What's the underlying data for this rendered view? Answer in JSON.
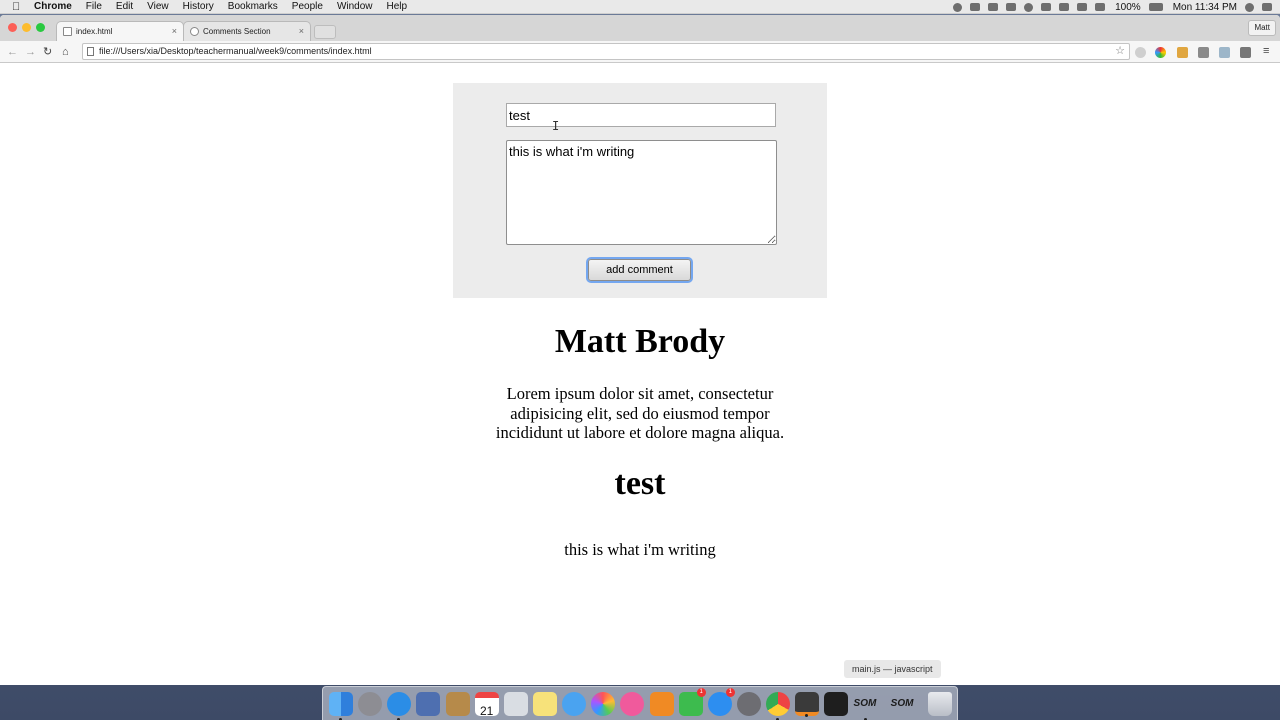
{
  "menubar": {
    "app_name": "Chrome",
    "items": [
      "File",
      "Edit",
      "View",
      "History",
      "Bookmarks",
      "People",
      "Window",
      "Help"
    ],
    "battery": "100%",
    "clock": "Mon 11:34 PM"
  },
  "browser": {
    "tabs": [
      {
        "title": "index.html",
        "active": true
      },
      {
        "title": "Comments Section",
        "active": false
      }
    ],
    "profile_name": "Matt",
    "url": "file:///Users/xia/Desktop/teachermanual/week9/comments/index.html"
  },
  "form": {
    "name_value": "test",
    "comment_value": "this is what i'm writing",
    "submit_label": "add comment"
  },
  "comments": [
    {
      "author": "Matt Brody",
      "text": "Lorem ipsum dolor sit amet, consectetur adipisicing elit, sed do eiusmod tempor incididunt ut labore et dolore magna aliqua."
    },
    {
      "author": "test",
      "text": "this is what i'm writing"
    }
  ],
  "dock": {
    "tooltip": "main.js — javascript",
    "calendar_day": "21",
    "som_label_1": "SOM",
    "som_label_2": "SOM",
    "badges": {
      "messages": "1",
      "appstore": "1"
    }
  }
}
